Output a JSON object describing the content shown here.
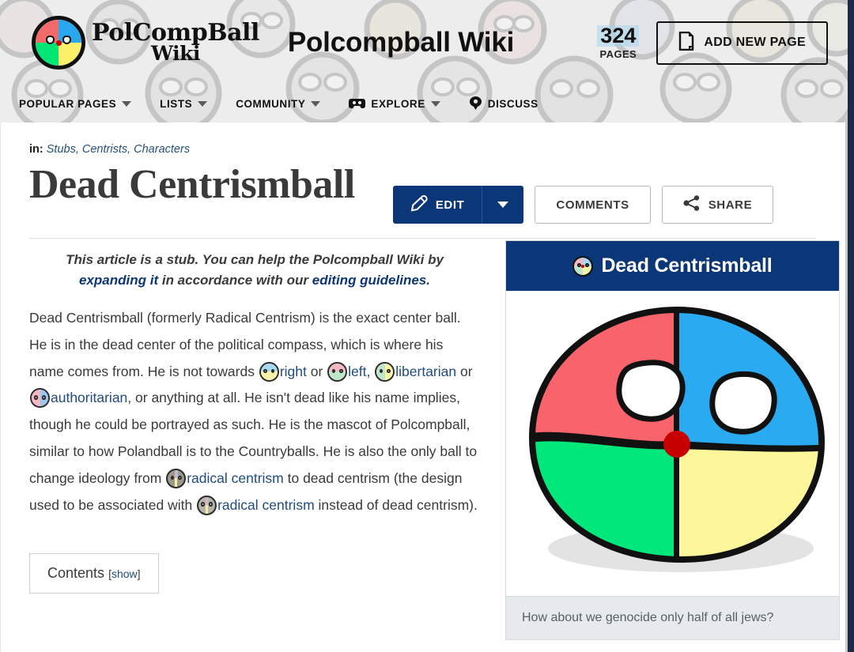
{
  "header": {
    "logo_wordmark_line1": "PolCompBall",
    "logo_wordmark_line2": "Wiki",
    "site_title": "Polcompball Wiki",
    "page_count_number": "324",
    "page_count_label": "PAGES",
    "add_new_page_label": "ADD NEW PAGE",
    "add_new_page_icon": "page-plus-icon",
    "nav_items": [
      {
        "label": "POPULAR PAGES",
        "has_caret": true,
        "icon": null
      },
      {
        "label": "LISTS",
        "has_caret": true,
        "icon": null
      },
      {
        "label": "COMMUNITY",
        "has_caret": true,
        "icon": null
      },
      {
        "label": "EXPLORE",
        "has_caret": true,
        "icon": "explore-icon"
      },
      {
        "label": "DISCUSS",
        "has_caret": false,
        "icon": "discuss-icon"
      }
    ]
  },
  "article": {
    "breadcrumb_prefix": "in:",
    "breadcrumb_categories": "Stubs, Centrists, Characters",
    "title": "Dead Centrismball",
    "actions": {
      "edit_label": "EDIT",
      "edit_icon": "pencil-icon",
      "edit_dropdown_icon": "chevron-down-icon",
      "comments_label": "COMMENTS",
      "share_label": "SHARE",
      "share_icon": "share-nodes-icon"
    },
    "stub_notice": {
      "part1": "This article is a stub. You can help the Polcompball Wiki by ",
      "link1": "expanding it",
      "part2": " in accordance with our ",
      "link2": "editing guidelines",
      "part3": "."
    },
    "body": {
      "t1": "Dead Centrismball (formerly Radical Centrism) is the exact center ball. He is in the dead center of the political compass, which is where his name comes from. He is not towards ",
      "link_right": "right",
      "t2": " or ",
      "link_left": "left",
      "t3": ", ",
      "link_libertarian": "libertarian",
      "t4": " or ",
      "link_authoritarian": "authoritarian",
      "t5": ", or anything at all. He isn't dead like his name implies, though he could be portrayed as such. He is the mascot of Polcompball, similar to how Polandball is to the Countryballs. He is also the only ball to change ideology from ",
      "link_radcent1": "radical centrism",
      "t6": " to dead centrism (the design used to be associated with ",
      "link_radcent2": "radical centrism",
      "t7": " instead of dead centrism)."
    },
    "contents": {
      "label": "Contents",
      "toggle_open": "[",
      "toggle_link": "show",
      "toggle_close": "]"
    }
  },
  "infobox": {
    "title": "Dead Centrismball",
    "title_icon": "dead-centrismball-icon",
    "image_alt": "dead-centrismball-illustration",
    "caption": "How about we genocide only half of all jews?"
  },
  "colors": {
    "brand_navy": "#0b3778",
    "link_blue": "#1f4b82",
    "header_bg": "#ececec",
    "ball_red": "#f9636b",
    "ball_blue": "#2aaaf0",
    "ball_green": "#00e87c",
    "ball_yellow": "#fbf79a",
    "ball_center_dot": "#c60000",
    "infobox_caption_bg": "#e6e9ed",
    "rail_navy": "#1b2a47"
  }
}
